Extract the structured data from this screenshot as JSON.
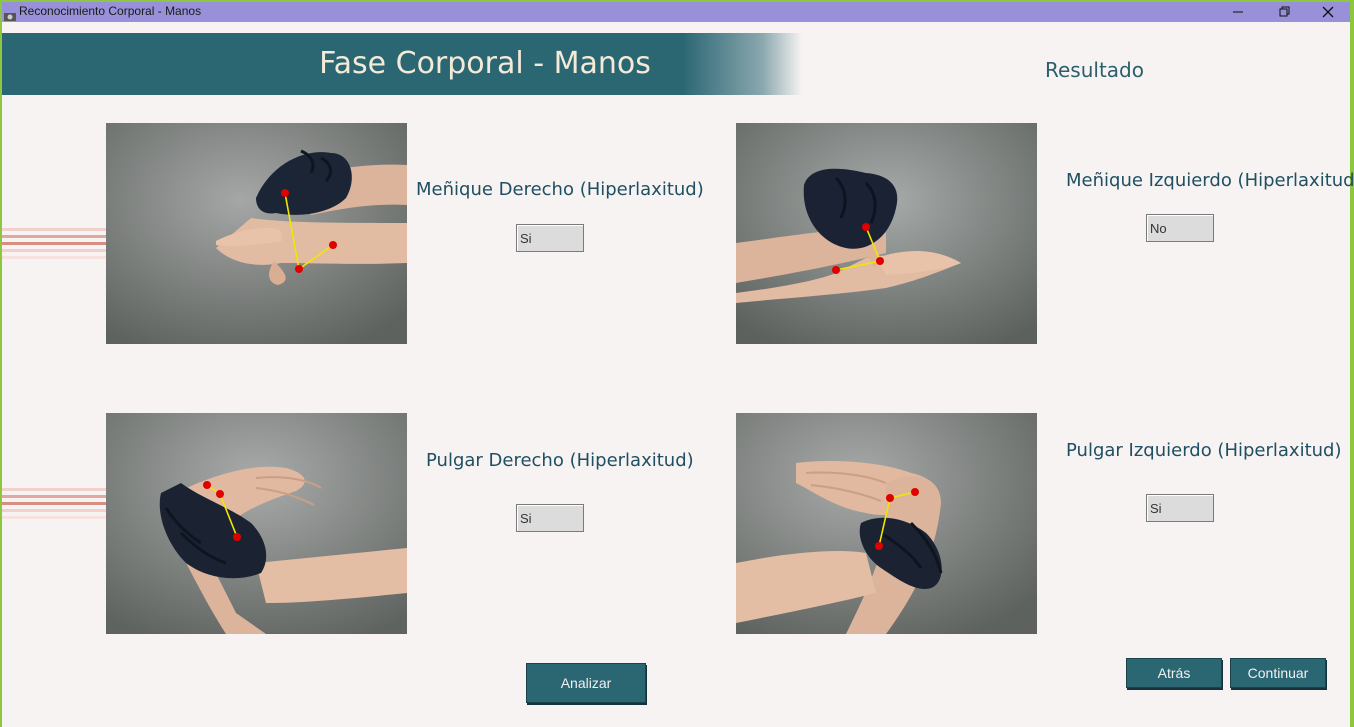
{
  "window": {
    "title": "Reconocimiento Corporal - Manos",
    "controls": [
      "minimize-icon",
      "restore-icon",
      "close-icon"
    ]
  },
  "header": {
    "title": "Fase Corporal - Manos",
    "result_title": "Resultado"
  },
  "tests": [
    {
      "label": "Meñique Derecho (Hiperlaxitud)",
      "result": "Si"
    },
    {
      "label": "Meñique Izquierdo (Hiperlaxitud)",
      "result": "No"
    },
    {
      "label": "Pulgar Derecho (Hiperlaxitud)",
      "result": "Si"
    },
    {
      "label": "Pulgar Izquierdo (Hiperlaxitud)",
      "result": "Si"
    }
  ],
  "buttons": {
    "analyze": "Analizar",
    "back": "Atrás",
    "continue": "Continuar"
  },
  "colors": {
    "accent": "#2b6673",
    "titlebar": "#9890d8",
    "window_border": "#8dc63f",
    "landmark_point": "#e00000",
    "landmark_line": "#f2e600"
  }
}
